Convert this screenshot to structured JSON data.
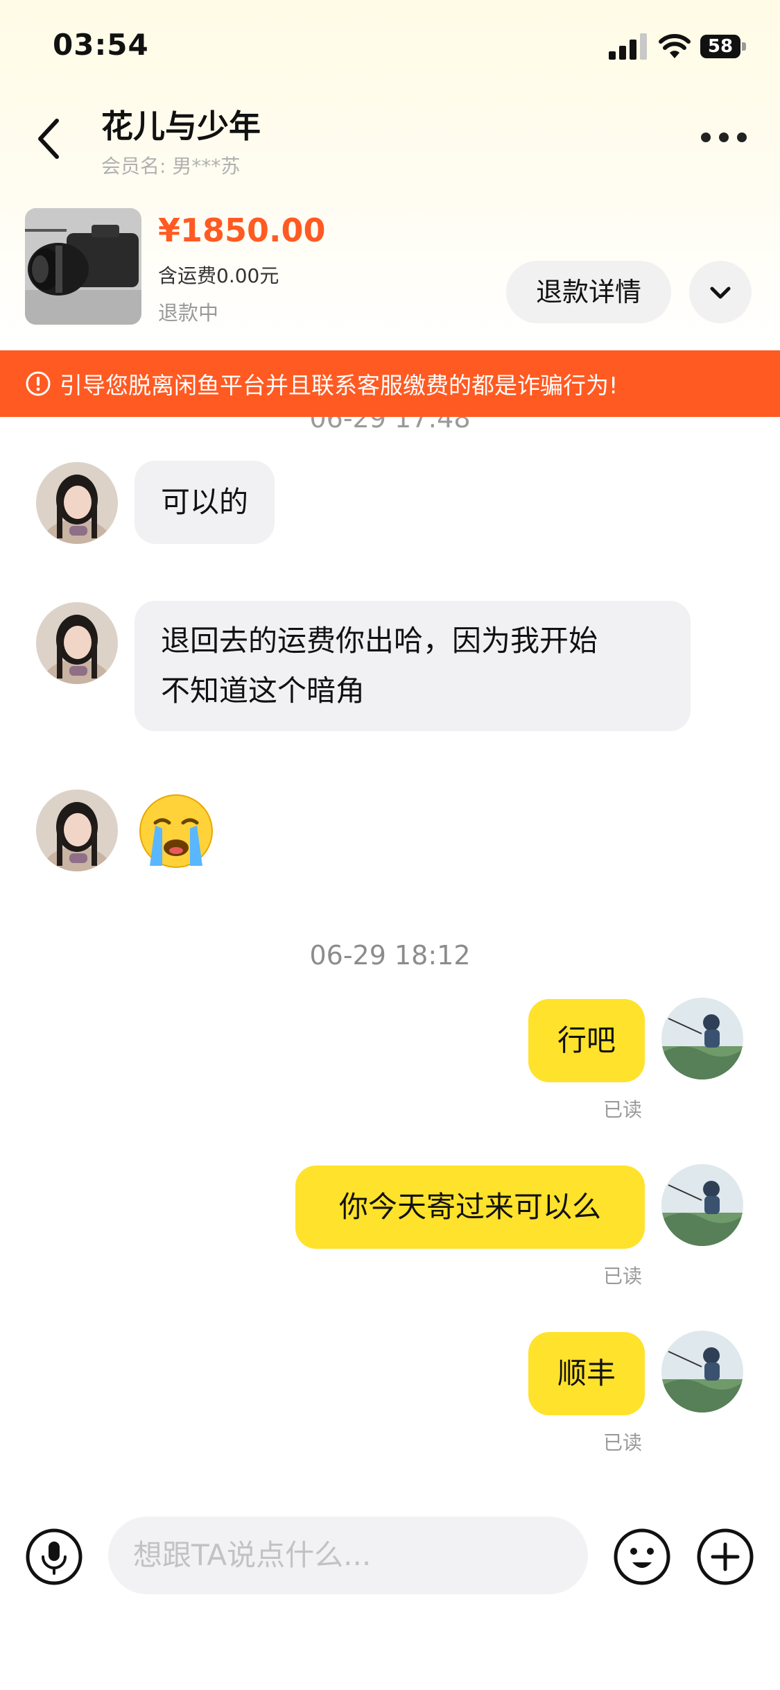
{
  "status_bar": {
    "time": "03:54",
    "battery": "58",
    "signal_icon": "cellular-signal-icon",
    "wifi_icon": "wifi-icon",
    "battery_icon": "battery-icon"
  },
  "header": {
    "title": "花儿与少年",
    "member_label": "会员名: 男***苏",
    "back_icon": "chevron-left-icon",
    "more_icon": "more-dots-icon"
  },
  "product": {
    "price": "¥1850.00",
    "shipping": "含运费0.00元",
    "status": "退款中",
    "refund_button": "退款详情",
    "expand_icon": "chevron-down-icon"
  },
  "warning": {
    "text": "引导您脱离闲鱼平台并且联系客服缴费的都是诈骗行为!",
    "icon": "alert-circle-icon"
  },
  "messages": {
    "timestamp_1": "06-29 17:48",
    "incoming_1": "可以的",
    "incoming_2_line1": "退回去的运费你出哈，因为我开始",
    "incoming_2_line2": "不知道这个暗角",
    "incoming_3_emoji": "😭",
    "timestamp_2": "06-29 18:12",
    "outgoing_1": "行吧",
    "outgoing_2": "你今天寄过来可以么",
    "outgoing_3": "顺丰",
    "read_label": "已读"
  },
  "input_bar": {
    "placeholder": "想跟TA说点什么...",
    "mic_icon": "microphone-icon",
    "emoji_icon": "emoji-icon",
    "plus_icon": "plus-circle-icon"
  },
  "colors": {
    "accent_orange": "#ff5a22",
    "bubble_yellow": "#ffe22b",
    "bubble_gray": "#f1f1f4"
  }
}
